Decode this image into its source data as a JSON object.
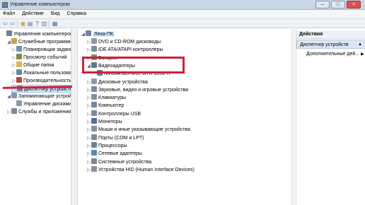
{
  "window": {
    "title": "Управление компьютером",
    "controls": [
      "–",
      "□",
      "×"
    ]
  },
  "menu": [
    "Файл",
    "Действие",
    "Вид",
    "Справка"
  ],
  "left_tree": [
    {
      "label": "Управление компьютером (л",
      "level": 0,
      "twisty": "",
      "color": "#6f7f95"
    },
    {
      "label": "Служебные программы",
      "level": 1,
      "twisty": "◢",
      "color": "#c9a24a"
    },
    {
      "label": "Планировщик задани",
      "level": 2,
      "twisty": "▷",
      "color": "#6c8fb8"
    },
    {
      "label": "Просмотр событий",
      "level": 2,
      "twisty": "▷",
      "color": "#7d8c4e"
    },
    {
      "label": "Общие папки",
      "level": 2,
      "twisty": "▷",
      "color": "#e0b64a"
    },
    {
      "label": "Локальные пользоват",
      "level": 2,
      "twisty": "▷",
      "color": "#6d86a6"
    },
    {
      "label": "Производительность",
      "level": 2,
      "twisty": "▷",
      "color": "#b84a3a"
    },
    {
      "label": "Диспетчер устройств",
      "level": 2,
      "twisty": "",
      "color": "#6f7f95"
    },
    {
      "label": "Запоминающие устройства",
      "level": 1,
      "twisty": "◢",
      "color": "#8a96a6"
    },
    {
      "label": "Управление дисками",
      "level": 2,
      "twisty": "",
      "color": "#8a96a6"
    },
    {
      "label": "Службы и приложения",
      "level": 1,
      "twisty": "▷",
      "color": "#7a8a9b"
    }
  ],
  "device_tree": {
    "root": "Леха-ПК",
    "items": [
      {
        "label": "DVD и CD-ROM дисководы",
        "level": 1,
        "twisty": "▷",
        "color": "#8e9aa8"
      },
      {
        "label": "IDE ATA/ATAPI контроллеры",
        "level": 1,
        "twisty": "▷",
        "color": "#7f8c9c"
      },
      {
        "label": "Батареи",
        "level": 1,
        "twisty": "▷",
        "color": "#6f9d56"
      },
      {
        "label": "Видеоадаптеры",
        "level": 1,
        "twisty": "◢",
        "color": "#5d7896"
      },
      {
        "label": "NVIDIA GeForce GTX 1050 Ti",
        "level": 2,
        "twisty": "",
        "color": "#5d7896"
      },
      {
        "label": "Дисковые устройства",
        "level": 1,
        "twisty": "▷",
        "color": "#8e9aa8"
      },
      {
        "label": "Звуковые, видео и игровые устройства",
        "level": 1,
        "twisty": "▷",
        "color": "#7a8aa0"
      },
      {
        "label": "Клавиатуры",
        "level": 1,
        "twisty": "▷",
        "color": "#8b8f96"
      },
      {
        "label": "Компьютер",
        "level": 1,
        "twisty": "▷",
        "color": "#6f86a4"
      },
      {
        "label": "Контроллеры USB",
        "level": 1,
        "twisty": "▷",
        "color": "#7b8897"
      },
      {
        "label": "Мониторы",
        "level": 1,
        "twisty": "▷",
        "color": "#4f6f98"
      },
      {
        "label": "Мыши и иные указывающие устройства",
        "level": 1,
        "twisty": "▷",
        "color": "#8b8f96"
      },
      {
        "label": "Порты (COM и LPT)",
        "level": 1,
        "twisty": "▷",
        "color": "#7b8897"
      },
      {
        "label": "Процессоры",
        "level": 1,
        "twisty": "▷",
        "color": "#6f7f95"
      },
      {
        "label": "Сетевые адаптеры",
        "level": 1,
        "twisty": "▷",
        "color": "#5c86b5"
      },
      {
        "label": "Системные устройства",
        "level": 1,
        "twisty": "▷",
        "color": "#7b8897"
      },
      {
        "label": "Устройства HID (Human Interface Devices)",
        "level": 1,
        "twisty": "▷",
        "color": "#8b8f96"
      }
    ]
  },
  "actions": {
    "header": "Действия",
    "section": "Диспетчер устройств",
    "more": "Дополнительные дей..."
  },
  "colors": {
    "highlight": "#d11f3a",
    "selection": "#cde8ff"
  }
}
